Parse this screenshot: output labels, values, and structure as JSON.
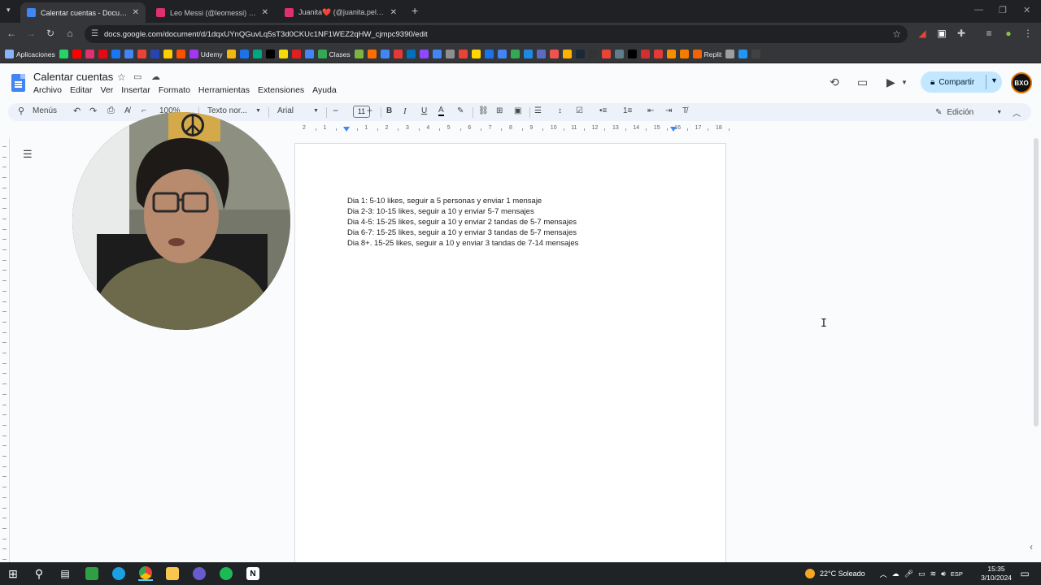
{
  "browser": {
    "tabs": [
      {
        "title": "Calentar cuentas - Documentos",
        "active": true,
        "favicon_color": "#4285f4"
      },
      {
        "title": "Leo Messi (@leomessi) • Fotos",
        "active": false,
        "favicon_color": "#e1306c"
      },
      {
        "title": "Juanita❤️ (@juanita.pellicoli) •",
        "active": false,
        "favicon_color": "#e1306c"
      }
    ],
    "new_tab": "+",
    "url": "docs.google.com/document/d/1dqxUYnQGuvLq5sT3d0CKUc1NF1WEZ2qHW_cjmpc9390/edit",
    "bookmarks": [
      {
        "label": "Aplicaciones",
        "color": "#8ab4f8"
      },
      {
        "label": "",
        "color": "#25d366"
      },
      {
        "label": "",
        "color": "#ff0000"
      },
      {
        "label": "",
        "color": "#e1306c"
      },
      {
        "label": "",
        "color": "#e50914"
      },
      {
        "label": "",
        "color": "#1877f2"
      },
      {
        "label": "",
        "color": "#4285f4"
      },
      {
        "label": "",
        "color": "#ea4335"
      },
      {
        "label": "",
        "color": "#2545b3"
      },
      {
        "label": "",
        "color": "#ffcc00"
      },
      {
        "label": "",
        "color": "#ff4f00"
      },
      {
        "label": "Udemy",
        "color": "#a435f0"
      },
      {
        "label": "",
        "color": "#f0b90b"
      },
      {
        "label": "",
        "color": "#1a73e8"
      },
      {
        "label": "",
        "color": "#00a680"
      },
      {
        "label": "",
        "color": "#000000"
      },
      {
        "label": "",
        "color": "#f5d90a"
      },
      {
        "label": "",
        "color": "#e02020"
      },
      {
        "label": "",
        "color": "#4285f4"
      },
      {
        "label": "Clases",
        "color": "#34a853"
      },
      {
        "label": "",
        "color": "#7cb342"
      },
      {
        "label": "",
        "color": "#ff6d00"
      },
      {
        "label": "",
        "color": "#4285f4"
      },
      {
        "label": "",
        "color": "#e53935"
      },
      {
        "label": "",
        "color": "#0070ba"
      },
      {
        "label": "",
        "color": "#9146ff"
      },
      {
        "label": "",
        "color": "#4285f4"
      },
      {
        "label": "",
        "color": "#8e8e8e"
      },
      {
        "label": "",
        "color": "#ea4335"
      },
      {
        "label": "",
        "color": "#ffd600"
      },
      {
        "label": "",
        "color": "#1a73e8"
      },
      {
        "label": "",
        "color": "#4285f4"
      },
      {
        "label": "",
        "color": "#34a853"
      },
      {
        "label": "",
        "color": "#1e88e5"
      },
      {
        "label": "",
        "color": "#5c6bc0"
      },
      {
        "label": "",
        "color": "#ef5350"
      },
      {
        "label": "",
        "color": "#ffb300"
      },
      {
        "label": "",
        "color": "#1b2838"
      },
      {
        "label": "",
        "color": "#333333"
      },
      {
        "label": "",
        "color": "#ea4335"
      },
      {
        "label": "",
        "color": "#607d8b"
      },
      {
        "label": "",
        "color": "#000000"
      },
      {
        "label": "",
        "color": "#d32f2f"
      },
      {
        "label": "",
        "color": "#e53935"
      },
      {
        "label": "",
        "color": "#fb8c00"
      },
      {
        "label": "",
        "color": "#f57c00"
      },
      {
        "label": "Replit",
        "color": "#f26207"
      },
      {
        "label": "",
        "color": "#9e9e9e"
      },
      {
        "label": "",
        "color": "#2196f3"
      },
      {
        "label": "",
        "color": "#424242"
      }
    ]
  },
  "docs": {
    "title": "Calentar cuentas",
    "menu": [
      "Archivo",
      "Editar",
      "Ver",
      "Insertar",
      "Formato",
      "Herramientas",
      "Extensiones",
      "Ayuda"
    ],
    "share_label": "Compartir",
    "avatar_text": "BXO",
    "toolbar": {
      "search_label": "Menús",
      "zoom": "100%",
      "style": "Texto nor...",
      "font": "Arial",
      "font_size": "11",
      "mode": "Edición"
    },
    "ruler_numbers": [
      "2",
      "1",
      "",
      "1",
      "2",
      "3",
      "4",
      "5",
      "6",
      "7",
      "8",
      "9",
      "10",
      "11",
      "12",
      "13",
      "14",
      "15",
      "16",
      "17",
      "18"
    ],
    "lines": [
      "Dia 1: 5-10 likes, seguir a 5 personas y enviar 1 mensaje",
      "Dia 2-3: 10-15 likes, seguir a 10 y enviar 5-7 mensajes",
      "Dia 4-5: 15-25 likes, seguir a 10 y enviar 2 tandas de 5-7 mensajes",
      "Dia 6-7: 15-25 likes, seguir a 10 y enviar 3 tandas de 5-7 mensajes",
      "Dia 8+. 15-25 likes, seguir a 10 y enviar 3 tandas de 7-14 mensajes"
    ]
  },
  "taskbar": {
    "weather": "22°C  Soleado",
    "lang": "ESP",
    "time": "15:35",
    "date": "3/10/2024"
  }
}
